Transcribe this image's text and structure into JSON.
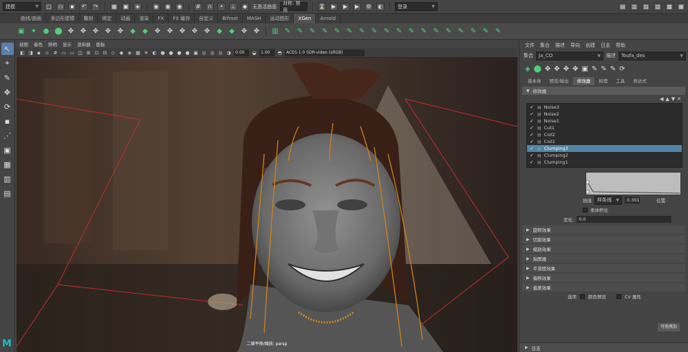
{
  "status": {
    "mode": "建模",
    "no_live_surface": "无激活曲面",
    "symmetry": "对称: 禁用",
    "login": "登录"
  },
  "shelf_tabs": [
    "曲线/曲面",
    "多边形建模",
    "雕刻",
    "绑定",
    "动画",
    "渲染",
    "FX",
    "FX 缓存",
    "自定义",
    "Bifrost",
    "MASH",
    "运动图形",
    "XGen",
    "Arnold"
  ],
  "active_shelf_tab": "XGen",
  "viewport": {
    "menu": [
      "视图",
      "着色",
      "照明",
      "显示",
      "渲染器",
      "面板"
    ],
    "exposure": "0.00",
    "gamma": "1.00",
    "color_space": "ACES 1.0 SDR-video (sRGB)",
    "camera_label": "二维平移/缩放: persp"
  },
  "xgen": {
    "menu": [
      "文件",
      "集合",
      "描述",
      "导向",
      "创建",
      "日志",
      "帮助"
    ],
    "collection_label": "集合",
    "collection_value": "Ja_CO",
    "description_label": "描述",
    "description_value": "Toufa_des",
    "tabs": [
      "基本体",
      "预览/输出",
      "修改器",
      "梳理",
      "工具",
      "表达式"
    ],
    "active_tab": "修改器",
    "section_title": "修改器",
    "modifiers": [
      {
        "name": "Noise3",
        "selected": false
      },
      {
        "name": "Noise2",
        "selected": false
      },
      {
        "name": "Noise1",
        "selected": false
      },
      {
        "name": "Cut1",
        "selected": false
      },
      {
        "name": "Coil2",
        "selected": false
      },
      {
        "name": "Coil1",
        "selected": false
      },
      {
        "name": "Clumping3",
        "selected": true
      },
      {
        "name": "Clumping2",
        "selected": false
      },
      {
        "name": "Clumping1",
        "selected": false
      }
    ],
    "interp_label": "插值",
    "interp_value": "样条线",
    "value_field": "0.301",
    "position_label": "位置:",
    "smooth_label": "柔体积化",
    "variation_label": "变化:",
    "variation_value": "0.0",
    "sections": [
      "旋转效果",
      "切割效果",
      "缩放效果",
      "贴图器",
      "平滑度效果",
      "偏移效果",
      "偏差效果"
    ],
    "options_label": "选项",
    "color_preview": "颜色预览",
    "cv_attr": "CV 属性",
    "close_btn": "可拖拽加",
    "log_label": "日志"
  }
}
